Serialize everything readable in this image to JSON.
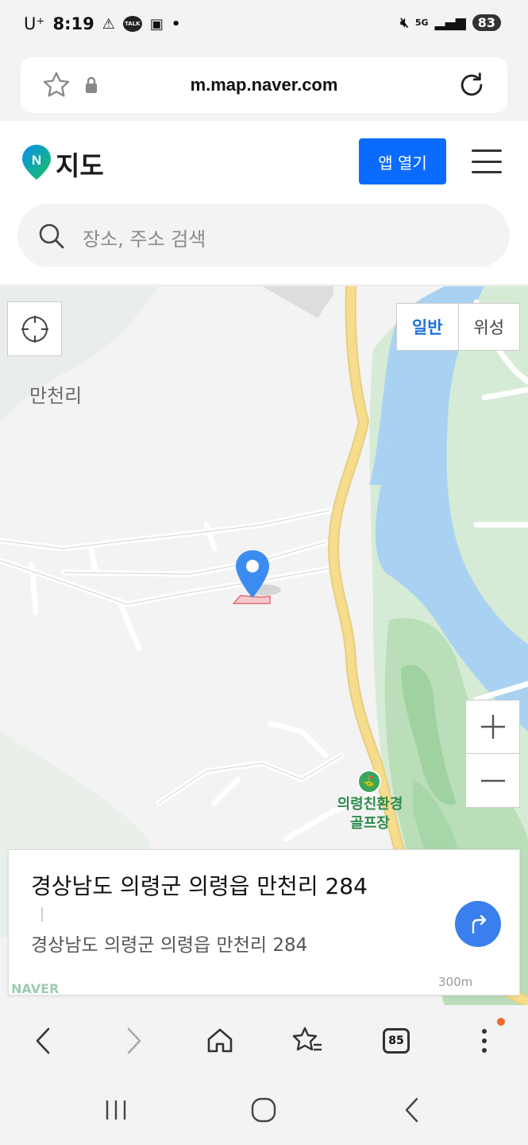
{
  "status_bar": {
    "carrier": "U⁺",
    "time": "8:19",
    "signal": "5G",
    "battery": "83"
  },
  "browser": {
    "url": "m.map.naver.com",
    "tabs_count": "85"
  },
  "header": {
    "logo_text": "지도",
    "open_app_label": "앱 열기",
    "search_placeholder": "장소, 주소 검색"
  },
  "map": {
    "village_label": "만천리",
    "map_types": [
      "일반",
      "위성"
    ],
    "active_map_type": "일반",
    "poi_label_line1": "의령친환경",
    "poi_label_line2": "골프장",
    "scale_label": "300m",
    "naver_watermark": "NAVER"
  },
  "info_card": {
    "title": "경상남도 의령군 의령읍 만천리 284",
    "address": "경상남도 의령군 의령읍 만천리 284"
  },
  "colors": {
    "accent": "#0b6bff",
    "river": "#a9d2f2",
    "forest": "#cfe8d2",
    "road_yellow": "#f6dc8c",
    "pin": "#3b8cf0"
  }
}
